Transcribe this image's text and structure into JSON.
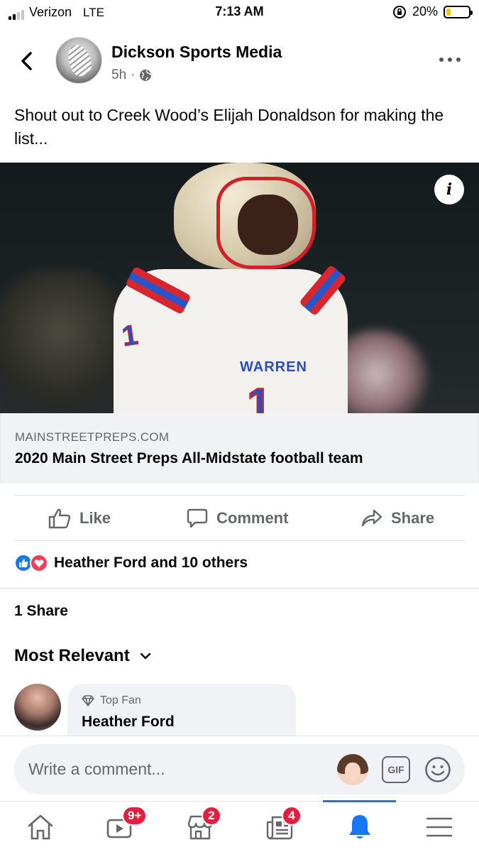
{
  "status_bar": {
    "carrier": "Verizon",
    "network": "LTE",
    "time": "7:13 AM",
    "battery": "20%",
    "battery_level": 0.2,
    "signal_bars_filled": 2
  },
  "post": {
    "page_name": "Dickson Sports Media",
    "time_ago": "5h",
    "privacy_icon": "globe-icon",
    "text": "Shout out to Creek Wood’s Elijah Donaldson for making the list...",
    "photo": {
      "jersey_text": "WARREN",
      "jersey_number": "1"
    },
    "link": {
      "domain": "MAINSTREETPREPS.COM",
      "title": "2020 Main Street Preps All-Midstate football team"
    }
  },
  "actions": {
    "like": "Like",
    "comment": "Comment",
    "share": "Share"
  },
  "reactions": {
    "summary": "Heather Ford and 10 others",
    "types": [
      "like",
      "love"
    ]
  },
  "shares": "1 Share",
  "comments": {
    "sort_label": "Most Relevant",
    "items": [
      {
        "badge": "Top Fan",
        "name": "Heather Ford"
      }
    ]
  },
  "composer": {
    "placeholder": "Write a comment...",
    "gif_label": "GIF"
  },
  "tab_bar": {
    "tabs": [
      {
        "name": "home",
        "badge": ""
      },
      {
        "name": "watch",
        "badge": "9+"
      },
      {
        "name": "marketplace",
        "badge": "2"
      },
      {
        "name": "news",
        "badge": "4"
      },
      {
        "name": "notifications",
        "badge": "",
        "active": true
      },
      {
        "name": "menu",
        "badge": ""
      }
    ]
  },
  "colors": {
    "accent": "#1877f2",
    "badge": "#e41e3f",
    "love": "#f33e58",
    "secondary_text": "#65676b"
  }
}
